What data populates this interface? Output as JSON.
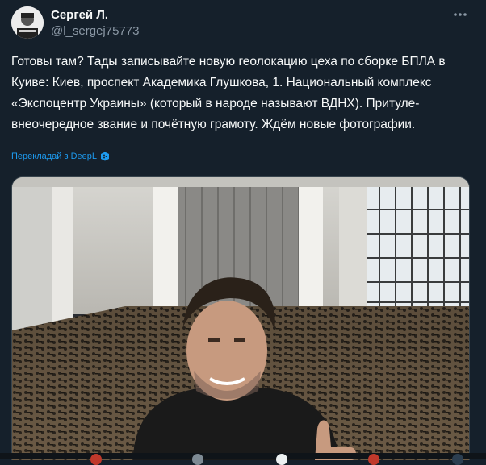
{
  "author": {
    "name": "Сергей Л.",
    "handle": "@l_sergej75773"
  },
  "tweet": {
    "text": "Готовы там? Тады записывайте новую геолокацию цеха по сборке БПЛА в Куиве: Киев, проспект Академика Глушкова, 1. Национальный комплекс «Экспоцентр Украины» (который в народе называют ВДНХ). Притуле-внеочередное звание и почётную грамоту. Ждём новые фотографии.",
    "translate_label": "Перекладай з DeepL"
  },
  "icons": {
    "more": "more-icon",
    "deepl": "deepl-icon",
    "avatar": "avatar"
  },
  "colors": {
    "background": "#15202b",
    "link": "#1d9bf0",
    "secondary_text": "#8b98a5"
  }
}
